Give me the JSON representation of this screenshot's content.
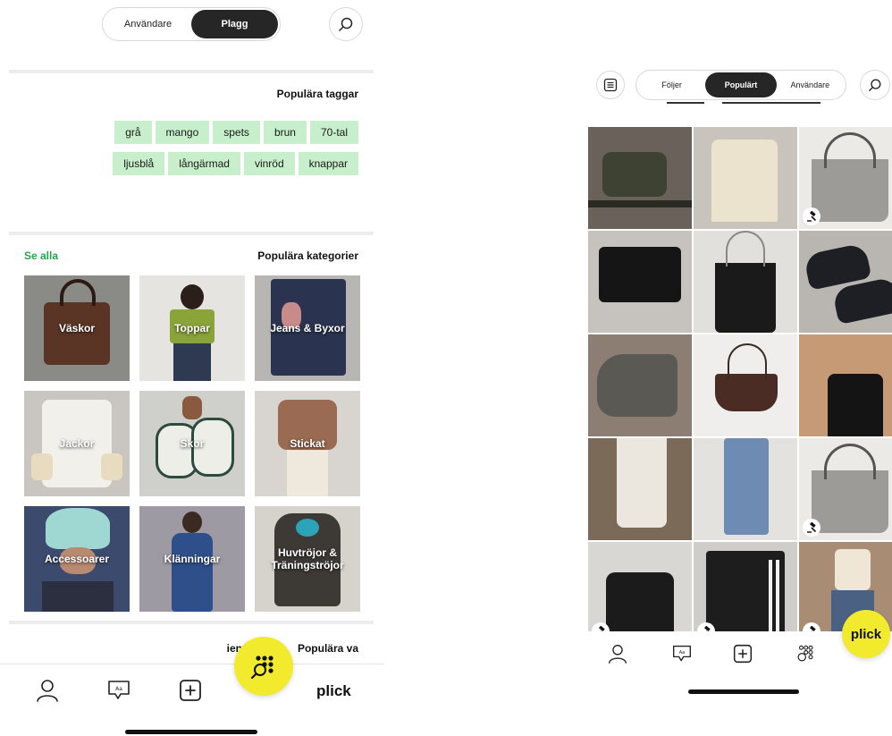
{
  "left_screen": {
    "segmented": {
      "option_a": "Användare",
      "option_b": "Plagg",
      "active": "Plagg"
    },
    "tags": {
      "title": "Populära taggar",
      "row1": [
        "grå",
        "mango",
        "spets",
        "brun",
        "70-tal"
      ],
      "row2": [
        "ljusblå",
        "långärmad",
        "vinröd",
        "knappar"
      ]
    },
    "categories": {
      "title": "Populära kategorier",
      "see_all": "Se alla",
      "items": [
        {
          "label": "Väskor"
        },
        {
          "label": "Toppar"
        },
        {
          "label": "Jeans & Byxor"
        },
        {
          "label": "Jackor"
        },
        {
          "label": "Skor"
        },
        {
          "label": "Stickat"
        },
        {
          "label": "Accessoarer"
        },
        {
          "label": "Klänningar"
        },
        {
          "label": "Huvtröjor & Träningströjor"
        }
      ]
    },
    "partial_section_title": "Populära va",
    "partial_section_suffix": "ien",
    "brand": "plick"
  },
  "right_screen": {
    "tabs": {
      "tab_a": "Följer",
      "tab_b": "Populärt",
      "tab_c": "Användare",
      "active": "Populärt"
    },
    "badge": "plick",
    "photos": [
      {
        "desc": "bag-olive",
        "auction": false
      },
      {
        "desc": "knit-top",
        "auction": false
      },
      {
        "desc": "grey-tote",
        "auction": true
      },
      {
        "desc": "black-clutch",
        "auction": false
      },
      {
        "desc": "black-chain-bag",
        "auction": false
      },
      {
        "desc": "black-sneakers",
        "auction": false
      },
      {
        "desc": "grey-sneakers",
        "auction": false
      },
      {
        "desc": "brown-baguette",
        "auction": false
      },
      {
        "desc": "black-top",
        "auction": false
      },
      {
        "desc": "white-jeans",
        "auction": false
      },
      {
        "desc": "blue-jeans",
        "auction": false
      },
      {
        "desc": "grey-tote-2",
        "auction": true
      },
      {
        "desc": "black-shoulder-bag",
        "auction": true
      },
      {
        "desc": "black-track-pants",
        "auction": true
      },
      {
        "desc": "low-rise-jeans",
        "auction": true
      }
    ]
  },
  "colors": {
    "tag_bg": "#c7efcb",
    "accent_green": "#22a84a",
    "active_dark": "#262626",
    "brand_yellow": "#f2ea2c"
  }
}
